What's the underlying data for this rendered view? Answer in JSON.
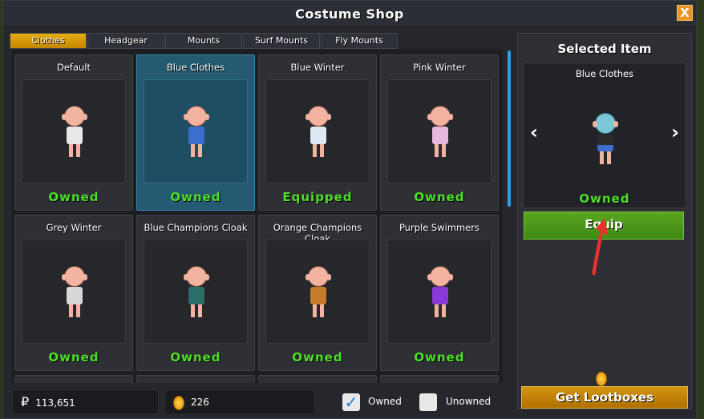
{
  "window": {
    "title": "Costume Shop",
    "close": "X"
  },
  "tabs": [
    {
      "label": "Clothes",
      "active": true
    },
    {
      "label": "Headgear"
    },
    {
      "label": "Mounts"
    },
    {
      "label": "Surf Mounts"
    },
    {
      "label": "Fly Mounts"
    }
  ],
  "items": [
    {
      "name": "Default",
      "status": "Owned",
      "color": "#e8e8e8"
    },
    {
      "name": "Blue Clothes",
      "status": "Owned",
      "color": "#3a6fd0",
      "selected": true
    },
    {
      "name": "Blue Winter",
      "status": "Equipped",
      "color": "#dfe8f5"
    },
    {
      "name": "Pink Winter",
      "status": "Owned",
      "color": "#e9b8e0"
    },
    {
      "name": "Grey Winter",
      "status": "Owned",
      "color": "#d8d8d8"
    },
    {
      "name": "Blue Champions Cloak",
      "status": "Owned",
      "color": "#2a6e6a"
    },
    {
      "name": "Orange Champions Cloak",
      "status": "Owned",
      "color": "#c77a2a"
    },
    {
      "name": "Purple Swimmers",
      "status": "Owned",
      "color": "#8a3ad8"
    }
  ],
  "selected": {
    "title": "Selected Item",
    "name": "Blue Clothes",
    "status": "Owned",
    "equip_label": "Equip",
    "prev": "‹",
    "next": "›"
  },
  "lootboxes_label": "Get Lootboxes",
  "balance": {
    "currency_symbol": "₽",
    "money": "113,651",
    "coins": "226"
  },
  "filters": {
    "owned": "Owned",
    "unowned": "Unowned",
    "owned_checked": true
  }
}
